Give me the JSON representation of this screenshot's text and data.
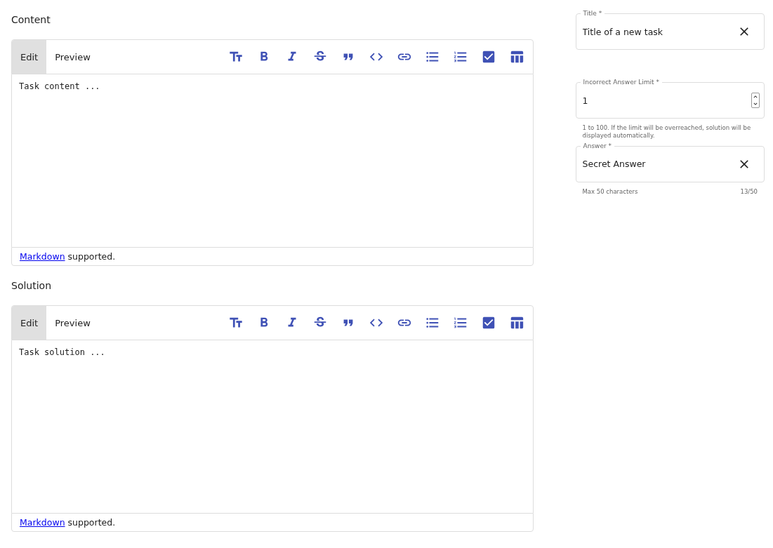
{
  "editors": [
    {
      "label": "Content",
      "tabs": [
        {
          "label": "Edit",
          "selected": true
        },
        {
          "label": "Preview",
          "selected": false
        }
      ],
      "placeholder": "Task content ...",
      "footer_link": "Markdown",
      "footer_text": "supported."
    },
    {
      "label": "Solution",
      "tabs": [
        {
          "label": "Edit",
          "selected": true
        },
        {
          "label": "Preview",
          "selected": false
        }
      ],
      "placeholder": "Task solution ...",
      "footer_link": "Markdown",
      "footer_text": "supported."
    }
  ],
  "title_field": {
    "label": "Title *",
    "value": "Title of a new task"
  },
  "limit_field": {
    "label": "Incorrect Answer Limit *",
    "value": "1",
    "helper": "1 to 100. If the limit will be overreached, solution will be displayed automatically."
  },
  "answer_field": {
    "label": "Answer *",
    "value": "Secret Answer",
    "helper": "Max 50 characters",
    "counter": "13/50"
  }
}
